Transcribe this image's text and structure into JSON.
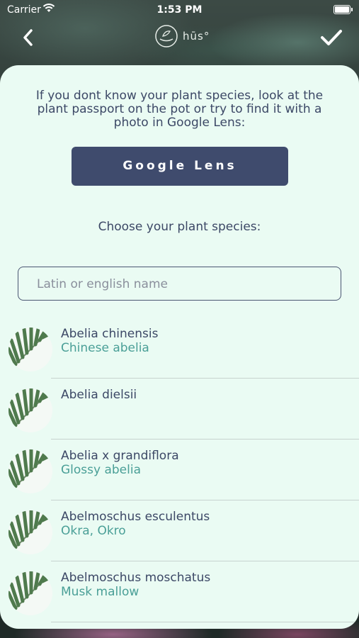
{
  "status_bar": {
    "carrier": "Carrier",
    "time": "1:53 PM"
  },
  "nav": {
    "logo_text": "hūs°",
    "back_icon": "chevron-left-icon",
    "confirm_icon": "checkmark-icon"
  },
  "card": {
    "intro_text": "If you dont know your plant species, look at the plant passport on the pot or try to find it with a photo in Google Lens:",
    "lens_button_label": "Google Lens",
    "choose_label": "Choose your plant species:",
    "search_placeholder": "Latin or english name"
  },
  "species": [
    {
      "latin": "Abelia chinensis",
      "common": "Chinese abelia"
    },
    {
      "latin": "Abelia dielsii",
      "common": ""
    },
    {
      "latin": "Abelia x grandiflora",
      "common": "Glossy abelia"
    },
    {
      "latin": "Abelmoschus esculentus",
      "common": "Okra, Okro"
    },
    {
      "latin": "Abelmoschus moschatus",
      "common": "Musk mallow"
    }
  ],
  "colors": {
    "primary": "#3f4b6d",
    "accent": "#4a9f97",
    "card_bg": "#eafbf3",
    "text": "#3c4866"
  }
}
